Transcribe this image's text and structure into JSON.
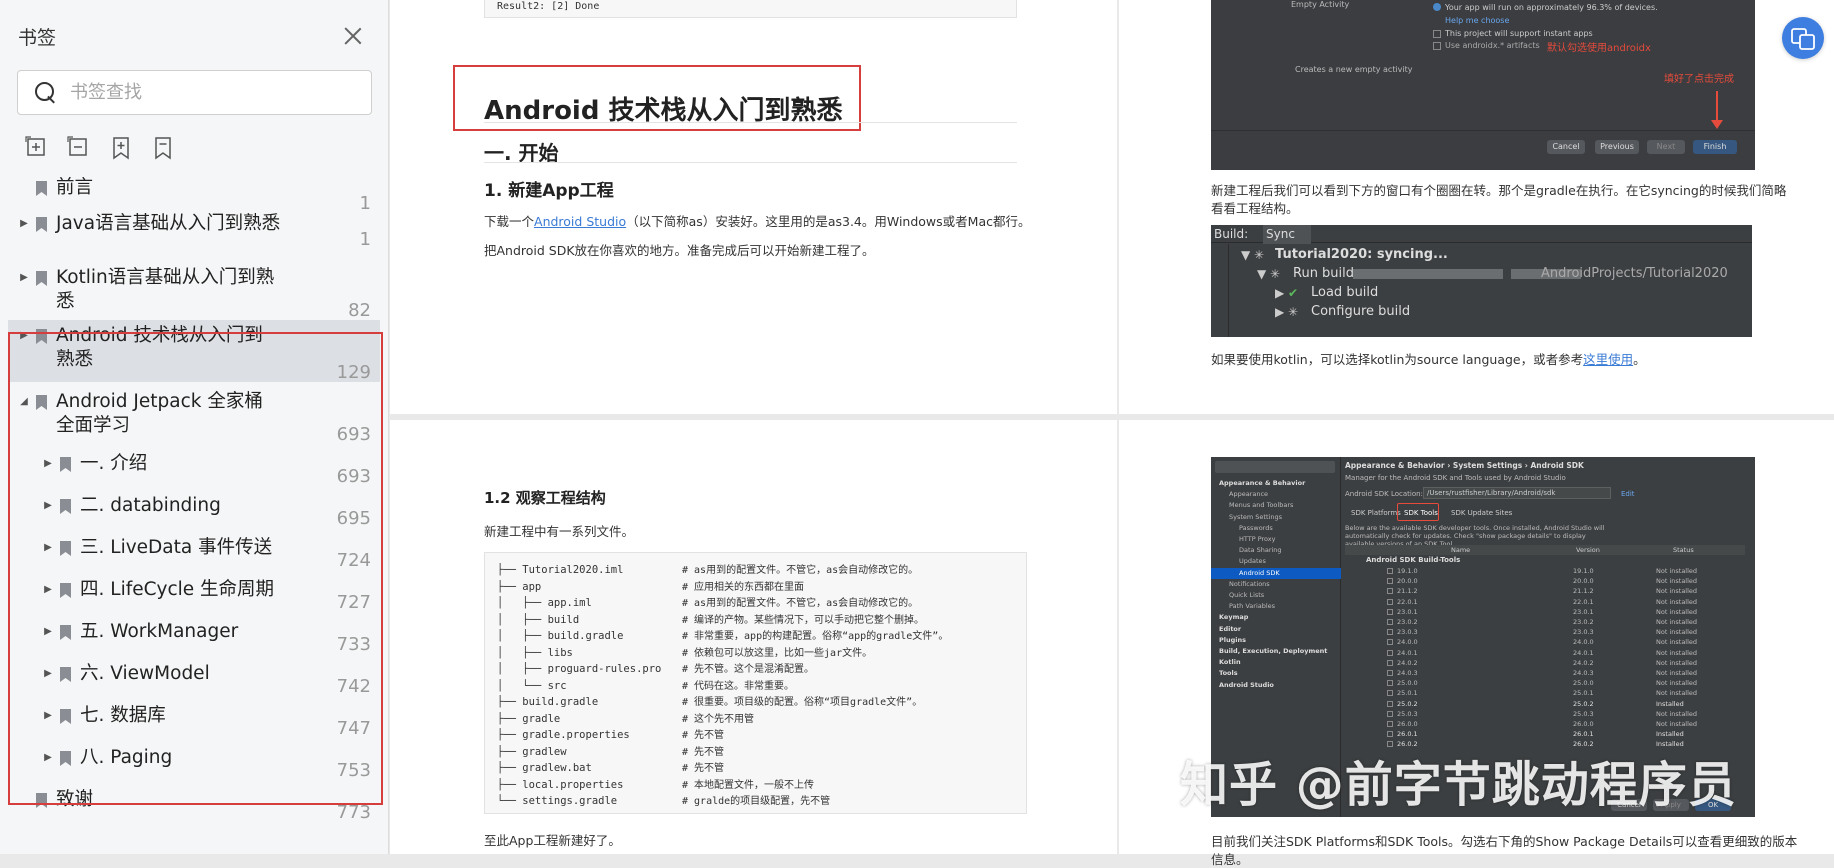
{
  "sidebar": {
    "title": "书签",
    "search_placeholder": "书签查找",
    "items": [
      {
        "label": "前言",
        "page": "1",
        "arrow": ""
      },
      {
        "label": "Java语言基础从入门到熟悉",
        "page": "1",
        "arrow": "▶"
      },
      {
        "label": "Kotlin语言基础从入门到熟悉",
        "page": "82",
        "arrow": "▶"
      },
      {
        "label": "Android 技术栈从入门到熟悉",
        "page": "129",
        "arrow": "▶"
      },
      {
        "label": "Android Jetpack 全家桶全面学习",
        "page": "693",
        "arrow": "◢"
      },
      {
        "label": "一. 介绍",
        "page": "693",
        "arrow": "▶"
      },
      {
        "label": "二. databinding",
        "page": "695",
        "arrow": "▶"
      },
      {
        "label": "三. LiveData 事件传送",
        "page": "724",
        "arrow": "▶"
      },
      {
        "label": "四. LifeCycle 生命周期",
        "page": "727",
        "arrow": "▶"
      },
      {
        "label": "五. WorkManager",
        "page": "733",
        "arrow": "▶"
      },
      {
        "label": "六. ViewModel",
        "page": "742",
        "arrow": "▶"
      },
      {
        "label": "七. 数据库",
        "page": "747",
        "arrow": "▶"
      },
      {
        "label": "八. Paging",
        "page": "753",
        "arrow": "▶"
      },
      {
        "label": "致谢",
        "page": "773",
        "arrow": ""
      }
    ]
  },
  "doc_left_top": {
    "code_tail": "Result2: [2] Done",
    "h1": "Android 技术栈从入门到熟悉",
    "h2": "一. 开始",
    "h3": "1. 新建App工程",
    "p1_pre": "下载一个",
    "p1_link": "Android Studio",
    "p1_post": "（以下简称as）安装好。这里用的是as3.4。用Windows或者Mac都行。",
    "p2": "把Android SDK放在你喜欢的地方。准备完成后可以开始新建工程了。"
  },
  "doc_right_top": {
    "empty_activity": "Empty Activity",
    "run_line": "Your app will run on approximately 96.3% of devices.",
    "help": "Help me choose",
    "instant": "This project will support instant apps",
    "androidx": "Use androidx.* artifacts",
    "androidx_note": "默认勾选使用androidx",
    "creates": "Creates a new empty activity",
    "finish_note": "填好了点击完成",
    "btn_cancel": "Cancel",
    "btn_prev": "Previous",
    "btn_next": "Next",
    "btn_finish": "Finish",
    "para1_a": "新建工程后我们可以看到下方的窗口有个圈圈在转。那个是gradle在执行。在它syncing的时候我们简略",
    "para1_b": "看看工程结构。",
    "build_label": "Build:",
    "sync_tab": "Sync",
    "sync_title": "Tutorial2020: syncing...",
    "run_build": "Run build",
    "path": "AndroidProjects/Tutorial2020",
    "load_build": "Load build",
    "configure_build": "Configure build",
    "para2_pre": "如果要使用kotlin，可以选择kotlin为source language，或者参考",
    "para2_link": "这里使用",
    "para2_post": "。"
  },
  "doc_left_bot": {
    "h3": "1.2 观察工程结构",
    "intro": "新建工程中有一系列文件。",
    "tree": [
      [
        "├── Tutorial2020.iml",
        "# as用到的配置文件。不管它，as会自动修改它的。"
      ],
      [
        "├── app",
        "# 应用相关的东西都在里面"
      ],
      [
        "│   ├── app.iml",
        "# as用到的配置文件。不管它，as会自动修改它的。"
      ],
      [
        "│   ├── build",
        "# 编译的产物。某些情况下，可以手动把它整个删掉。"
      ],
      [
        "│   ├── build.gradle",
        "# 非常重要，app的构建配置。俗称“app的gradle文件”。"
      ],
      [
        "│   ├── libs",
        "# 依赖包可以放这里，比如一些jar文件。"
      ],
      [
        "│   ├── proguard-rules.pro",
        "# 先不管。这个是混淆配置。"
      ],
      [
        "│   └── src",
        "# 代码在这。非常重要。"
      ],
      [
        "├── build.gradle",
        "# 很重要。项目级的配置。俗称“项目gradle文件”。"
      ],
      [
        "├── gradle",
        "# 这个先不用管"
      ],
      [
        "├── gradle.properties",
        "# 先不管"
      ],
      [
        "├── gradlew",
        "# 先不管"
      ],
      [
        "├── gradlew.bat",
        "# 先不管"
      ],
      [
        "├── local.properties",
        "# 本地配置文件，一般不上传"
      ],
      [
        "└── settings.gradle",
        "# gralde的项目级配置，先不管"
      ]
    ],
    "outro": "至此App工程新建好了。"
  },
  "doc_right_bot": {
    "breadcrumb": "Appearance & Behavior  ›  System Settings  ›  Android SDK",
    "manager_line": "Manager for the Android SDK and Tools used by Android Studio",
    "location_label": "Android SDK Location:",
    "location_value": "/Users/rustfisher/Library/Android/sdk",
    "edit": "Edit",
    "tab_platforms": "SDK Platforms",
    "tab_tools": "SDK Tools",
    "tab_update": "SDK Update Sites",
    "desc": "Below are the available SDK developer tools. Once installed, Android Studio will automatically check for updates. Check \"show package details\" to display available versions of an SDK Tool.",
    "col_name": "Name",
    "col_version": "Version",
    "col_status": "Status",
    "group": "Android SDK Build-Tools",
    "nav": [
      "Appearance & Behavior",
      "Appearance",
      "Menus and Toolbars",
      "System Settings",
      "Passwords",
      "HTTP Proxy",
      "Data Sharing",
      "Updates",
      "Android SDK",
      "Notifications",
      "Quick Lists",
      "Path Variables",
      "Keymap",
      "Editor",
      "Plugins",
      "Build, Execution, Deployment",
      "Kotlin",
      "Tools",
      "Android Studio"
    ],
    "rows": [
      [
        "19.1.0",
        "19.1.0",
        "Not installed"
      ],
      [
        "20.0.0",
        "20.0.0",
        "Not installed"
      ],
      [
        "21.1.2",
        "21.1.2",
        "Not installed"
      ],
      [
        "22.0.1",
        "22.0.1",
        "Not installed"
      ],
      [
        "23.0.1",
        "23.0.1",
        "Not installed"
      ],
      [
        "23.0.2",
        "23.0.2",
        "Not installed"
      ],
      [
        "23.0.3",
        "23.0.3",
        "Not installed"
      ],
      [
        "24.0.0",
        "24.0.0",
        "Not installed"
      ],
      [
        "24.0.1",
        "24.0.1",
        "Not installed"
      ],
      [
        "24.0.2",
        "24.0.2",
        "Not installed"
      ],
      [
        "24.0.3",
        "24.0.3",
        "Not installed"
      ],
      [
        "25.0.0",
        "25.0.0",
        "Not installed"
      ],
      [
        "25.0.1",
        "25.0.1",
        "Not installed"
      ],
      [
        "25.0.2",
        "25.0.2",
        "Installed"
      ],
      [
        "25.0.3",
        "25.0.3",
        "Not installed"
      ],
      [
        "26.0.0",
        "26.0.0",
        "Not installed"
      ],
      [
        "26.0.1",
        "26.0.1",
        "Installed"
      ],
      [
        "26.0.2",
        "26.0.2",
        "Installed"
      ]
    ],
    "btn_cancel": "Cancel",
    "btn_apply": "Apply",
    "btn_ok": "OK",
    "para_a": "目前我们关注SDK Platforms和SDK Tools。勾选右下角的Show Package Details可以查看更细致的版本",
    "para_b": "信息。"
  },
  "watermark": "知乎 @前字节跳动程序员",
  "colors": {
    "accent_red": "#d63d3d",
    "link": "#3a7bd5",
    "ide_blue": "#4a88c7"
  }
}
